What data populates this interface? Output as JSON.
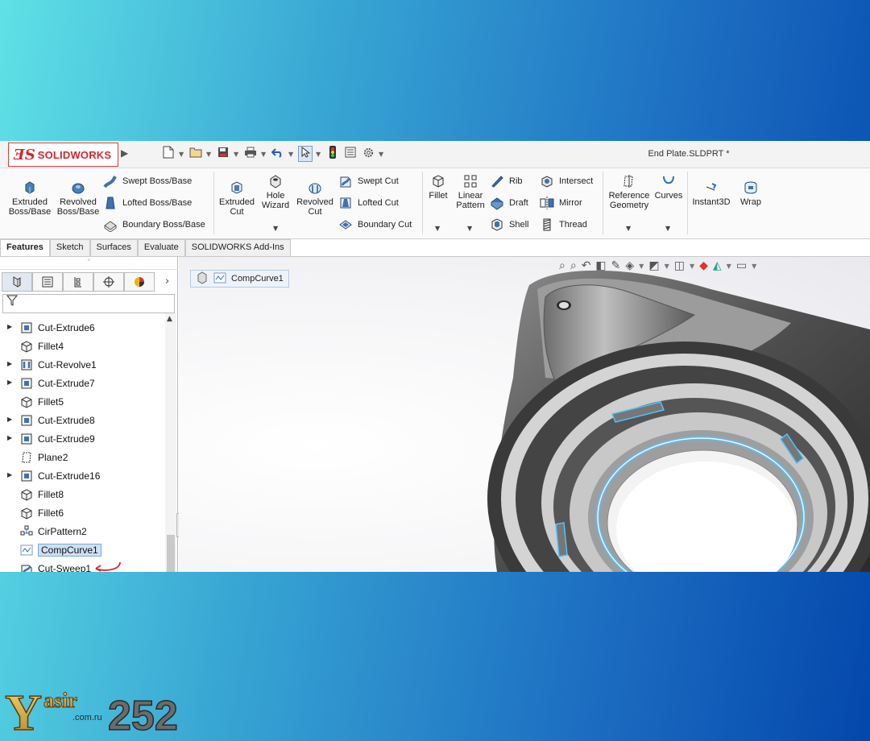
{
  "app": {
    "logo_ds": "ƎS",
    "logo_text": "SOLIDWORKS",
    "file_title": "End Plate.SLDPRT *"
  },
  "quick_access": [
    {
      "name": "new-document-icon",
      "glyph": "🗋"
    },
    {
      "name": "open-icon",
      "glyph": "📂"
    },
    {
      "name": "save-icon",
      "glyph": "💾"
    },
    {
      "name": "print-icon",
      "glyph": "🖶"
    },
    {
      "name": "undo-icon",
      "glyph": "↶"
    },
    {
      "name": "select-icon",
      "glyph": "⇱"
    },
    {
      "name": "rebuild-icon",
      "glyph": "🚦"
    },
    {
      "name": "file-properties-icon",
      "glyph": "☰"
    },
    {
      "name": "options-gear-icon",
      "glyph": "⚙"
    }
  ],
  "ribbon": {
    "extruded_boss": "Extruded Boss/Base",
    "revolved_boss": "Revolved Boss/Base",
    "swept_boss": "Swept Boss/Base",
    "lofted_boss": "Lofted Boss/Base",
    "boundary_boss": "Boundary Boss/Base",
    "extruded_cut": "Extruded Cut",
    "hole_wizard": "Hole Wizard",
    "revolved_cut": "Revolved Cut",
    "swept_cut": "Swept Cut",
    "lofted_cut": "Lofted Cut",
    "boundary_cut": "Boundary Cut",
    "fillet": "Fillet",
    "linear_pattern": "Linear Pattern",
    "rib": "Rib",
    "draft": "Draft",
    "shell": "Shell",
    "intersect": "Intersect",
    "mirror": "Mirror",
    "thread": "Thread",
    "reference_geometry": "Reference Geometry",
    "curves": "Curves",
    "instant3d": "Instant3D",
    "wrap": "Wrap"
  },
  "tabs": [
    "Features",
    "Sketch",
    "Surfaces",
    "Evaluate",
    "SOLIDWORKS Add-Ins"
  ],
  "tree": [
    {
      "label": "Cut-Extrude6",
      "icon": "cut-extrude-icon",
      "expandable": true
    },
    {
      "label": "Fillet4",
      "icon": "fillet-icon",
      "expandable": false
    },
    {
      "label": "Cut-Revolve1",
      "icon": "cut-revolve-icon",
      "expandable": true
    },
    {
      "label": "Cut-Extrude7",
      "icon": "cut-extrude-icon",
      "expandable": true
    },
    {
      "label": "Fillet5",
      "icon": "fillet-icon",
      "expandable": false
    },
    {
      "label": "Cut-Extrude8",
      "icon": "cut-extrude-icon",
      "expandable": true
    },
    {
      "label": "Cut-Extrude9",
      "icon": "cut-extrude-icon",
      "expandable": true
    },
    {
      "label": "Plane2",
      "icon": "plane-icon",
      "expandable": false
    },
    {
      "label": "Cut-Extrude16",
      "icon": "cut-extrude-icon",
      "expandable": true
    },
    {
      "label": "Fillet8",
      "icon": "fillet-icon",
      "expandable": false
    },
    {
      "label": "Fillet6",
      "icon": "fillet-icon",
      "expandable": false
    },
    {
      "label": "CirPattern2",
      "icon": "circular-pattern-icon",
      "expandable": false
    },
    {
      "label": "CompCurve1",
      "icon": "composite-curve-icon",
      "expandable": false,
      "selected": true
    },
    {
      "label": "Cut-Sweep1",
      "icon": "cut-sweep-icon",
      "expandable": false,
      "annotated": true
    }
  ],
  "breadcrumb": {
    "label": "CompCurve1"
  },
  "colors": {
    "brand_red": "#d22630",
    "selection_blue": "#cde0f5",
    "highlight_glow": "#4fc3ff",
    "annotation_red": "#e02020"
  },
  "watermark": {
    "part1": "Yasir",
    "part2": "252",
    "sub": ".com.ru"
  }
}
